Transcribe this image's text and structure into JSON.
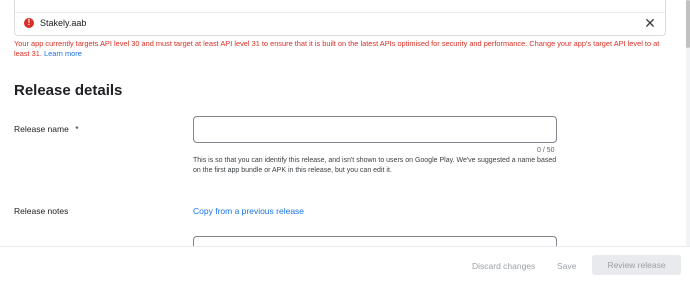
{
  "upload": {
    "file_name": "Stakely.aab",
    "status_icon": "error-icon",
    "close_icon": "close-icon"
  },
  "error": {
    "message": "Your app currently targets API level 30 and must target at least API level 31 to ensure that it is built on the latest APIs optimised for security and performance. Change your app's target API level to at least 31.",
    "link_label": "Learn more"
  },
  "release_details": {
    "title": "Release details",
    "release_name_label": "Release name",
    "required_marker": "*",
    "release_name_value": "",
    "counter": "0 / 50",
    "helper": "This is so that you can identify this release, and isn't shown to users on Google Play. We've suggested a name based on the first app bundle or APK in this release, but you can edit it.",
    "release_notes_label": "Release notes",
    "copy_link": "Copy from a previous release"
  },
  "footer": {
    "discard_label": "Discard changes",
    "save_label": "Save",
    "review_label": "Review release"
  },
  "colors": {
    "error": "#d93025",
    "link": "#1a73e8",
    "disabled_text": "#9aa0a6",
    "disabled_bg": "#e8eaed"
  }
}
